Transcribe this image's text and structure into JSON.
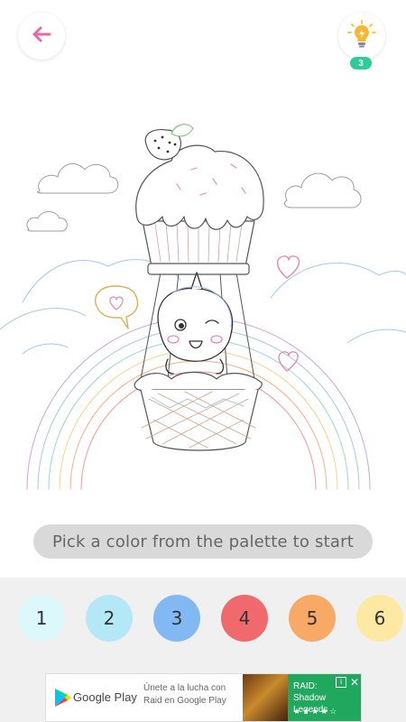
{
  "toolbar": {
    "back_icon": "arrow-left-icon",
    "hint_icon": "lightbulb-icon",
    "hint_count": "3",
    "accent": "#e56aa6"
  },
  "hint_bar": {
    "text": "Pick a color from the palette to start"
  },
  "palette": {
    "swatches": [
      {
        "label": "1",
        "color": "#ddf8fb"
      },
      {
        "label": "2",
        "color": "#b5e8f7"
      },
      {
        "label": "3",
        "color": "#82b9f3"
      },
      {
        "label": "4",
        "color": "#f06a6d"
      },
      {
        "label": "5",
        "color": "#f7a965"
      },
      {
        "label": "6",
        "color": "#fde9a2"
      }
    ]
  },
  "ad": {
    "brand": "Google Play",
    "message": "Únete a la lucha con Raid en Google Play",
    "app_title": "RAID: Shadow Legends",
    "stars": "★★★★☆"
  }
}
